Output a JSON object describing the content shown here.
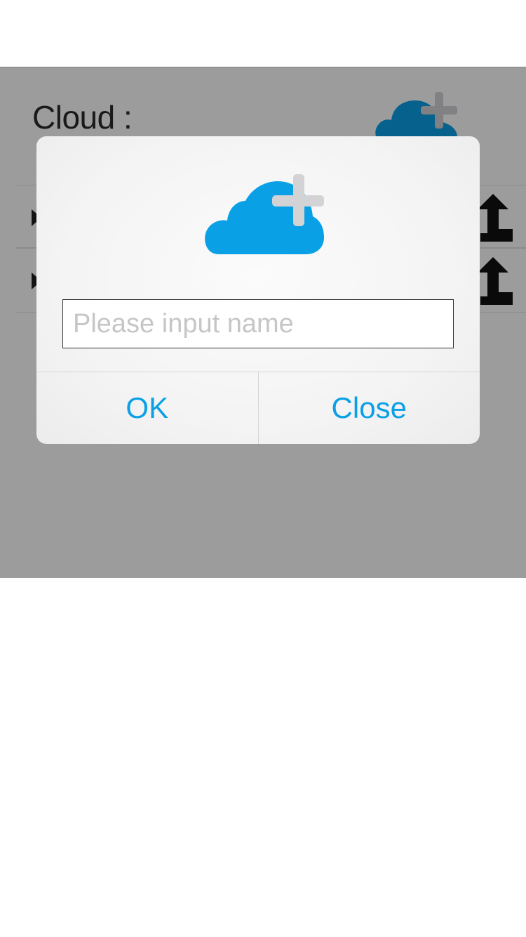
{
  "screen": {
    "cloud_label": "Cloud :",
    "rows": [
      {
        "expand_icon": "caret-right-icon",
        "action_icon": "upload-icon"
      },
      {
        "expand_icon": "caret-right-icon",
        "action_icon": "upload-icon"
      }
    ],
    "add_icon": "cloud-plus-icon"
  },
  "dialog": {
    "icon": "cloud-plus-icon",
    "input": {
      "value": "",
      "placeholder": "Please input name"
    },
    "ok_label": "OK",
    "close_label": "Close"
  },
  "colors": {
    "accent": "#0aa0e6",
    "overlay": "rgba(0,0,0,0.39)",
    "plus": "#d3d3d6"
  }
}
